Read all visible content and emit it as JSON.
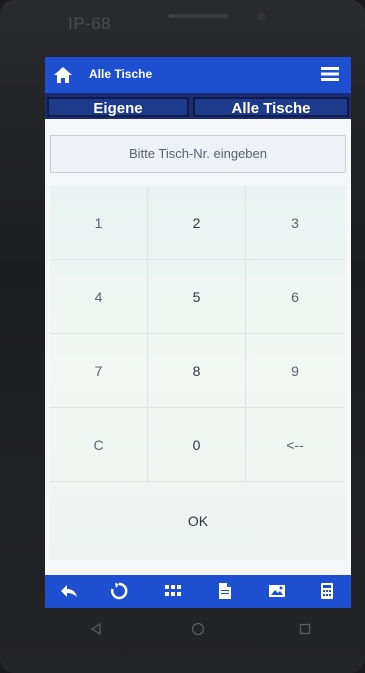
{
  "device": {
    "label": "IP-68"
  },
  "header": {
    "title": "Alle Tische",
    "home_icon": "home-icon",
    "menu_icon": "hamburger-menu-icon"
  },
  "tabs": [
    {
      "label": "Eigene"
    },
    {
      "label": "Alle Tische"
    }
  ],
  "input": {
    "placeholder": "Bitte Tisch-Nr. eingeben"
  },
  "keypad": {
    "keys": [
      [
        "1",
        "2",
        "3"
      ],
      [
        "4",
        "5",
        "6"
      ],
      [
        "7",
        "8",
        "9"
      ],
      [
        "C",
        "0",
        "<--"
      ]
    ],
    "ok_label": "OK"
  },
  "bottom_toolbar": {
    "icons": [
      "back-arrow-icon",
      "refresh-icon",
      "grid-icon",
      "document-icon",
      "image-icon",
      "calculator-icon"
    ]
  },
  "system_nav": {
    "icons": [
      "back-triangle-icon",
      "home-circle-icon",
      "recents-square-icon"
    ]
  },
  "colors": {
    "accent": "#1f4fd1",
    "tab_bg": "#1e3a8a"
  }
}
